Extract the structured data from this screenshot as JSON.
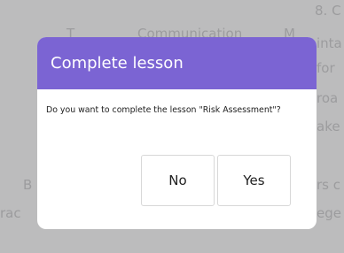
{
  "background": {
    "fragments": [
      "8. C",
      "T",
      "Communication",
      "M",
      "inta",
      "for",
      "roa",
      "ake",
      "B",
      "rs c",
      "rac",
      "ege"
    ]
  },
  "dialog": {
    "title": "Complete lesson",
    "message": "Do you want to complete the lesson \"Risk Assessment\"?",
    "buttons": {
      "no_label": "No",
      "yes_label": "Yes"
    }
  },
  "colors": {
    "header": "#7b64d3",
    "overlay": "#bcbcbd",
    "dialog_bg": "#ffffff"
  }
}
